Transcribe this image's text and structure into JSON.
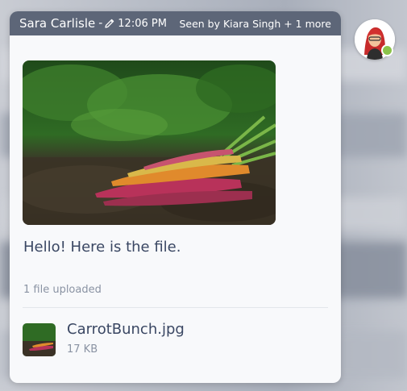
{
  "header": {
    "sender": "Sara Carlisle",
    "separator": "-",
    "time": "12:06 PM",
    "seen": "Seen by Kiara Singh + 1 more"
  },
  "message": {
    "text": "Hello! Here is the file.",
    "upload_count": "1 file uploaded"
  },
  "file": {
    "name": "CarrotBunch.jpg",
    "size": "17 KB"
  },
  "icons": {
    "edited": "pencil-icon",
    "presence": "online-status-dot"
  },
  "colors": {
    "header_bg": "#5d6678",
    "card_bg": "#f8f9fb",
    "text_primary": "#3a4763",
    "text_muted": "#8a93a3",
    "online": "#8bc34a"
  }
}
